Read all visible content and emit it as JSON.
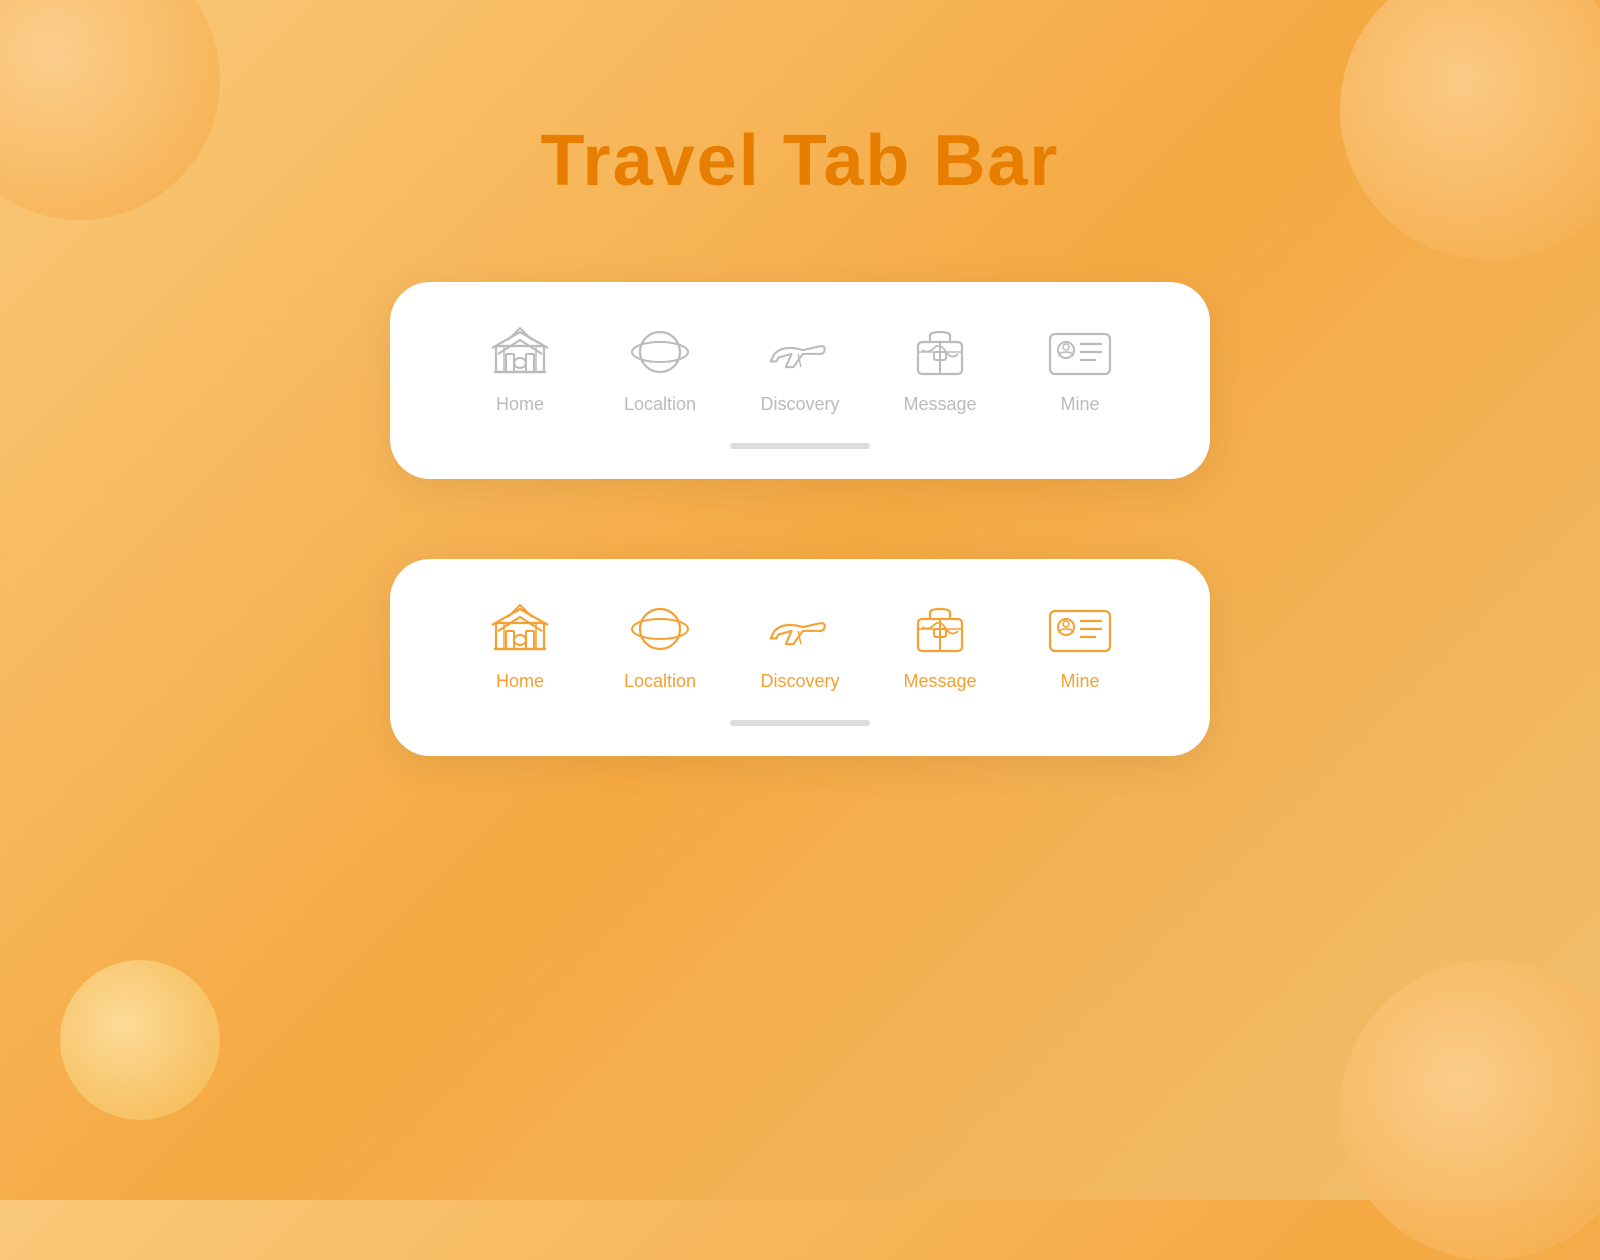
{
  "page": {
    "title": "Travel Tab Bar",
    "bg_color": "#f5b04a",
    "accent_color": "#e87e00",
    "orange_color": "#f5a030"
  },
  "tab_bar_inactive": {
    "items": [
      {
        "id": "home",
        "label": "Home"
      },
      {
        "id": "location",
        "label": "Localtion"
      },
      {
        "id": "discovery",
        "label": "Discovery"
      },
      {
        "id": "message",
        "label": "Message"
      },
      {
        "id": "mine",
        "label": "Mine"
      }
    ]
  },
  "tab_bar_active": {
    "items": [
      {
        "id": "home",
        "label": "Home"
      },
      {
        "id": "location",
        "label": "Localtion"
      },
      {
        "id": "discovery",
        "label": "Discovery"
      },
      {
        "id": "message",
        "label": "Message"
      },
      {
        "id": "mine",
        "label": "Mine"
      }
    ]
  }
}
